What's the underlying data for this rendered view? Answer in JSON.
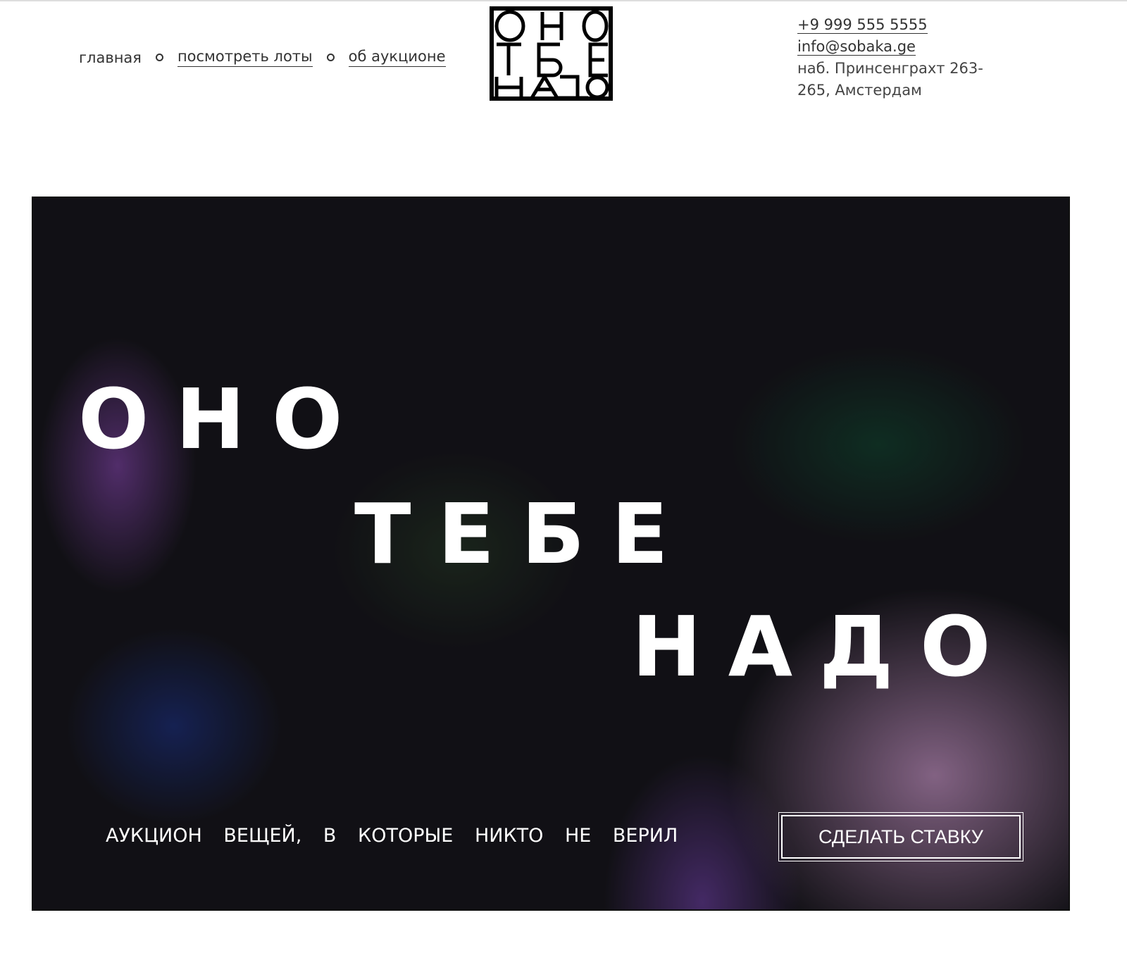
{
  "nav": {
    "items": [
      {
        "label": "главная"
      },
      {
        "label": "посмотреть лоты"
      },
      {
        "label": "об аукционе"
      }
    ]
  },
  "logo": {
    "text": "ОНО ТЕБЕ НАДО"
  },
  "contacts": {
    "phone": "+9 999 555 5555",
    "email": "info@sobaka.ge",
    "address_line1": "наб. Принсенграхт 263-",
    "address_line2": "265, Амстердам"
  },
  "hero": {
    "line1": "ОНО",
    "line2": "ТЕБЕ",
    "line3": "НАДО",
    "subtitle": "АУКЦИОН ВЕЩЕЙ, В КОТОРЫЕ НИКТО НЕ ВЕРИЛ",
    "cta_label": "СДЕЛАТЬ СТАВКУ"
  }
}
